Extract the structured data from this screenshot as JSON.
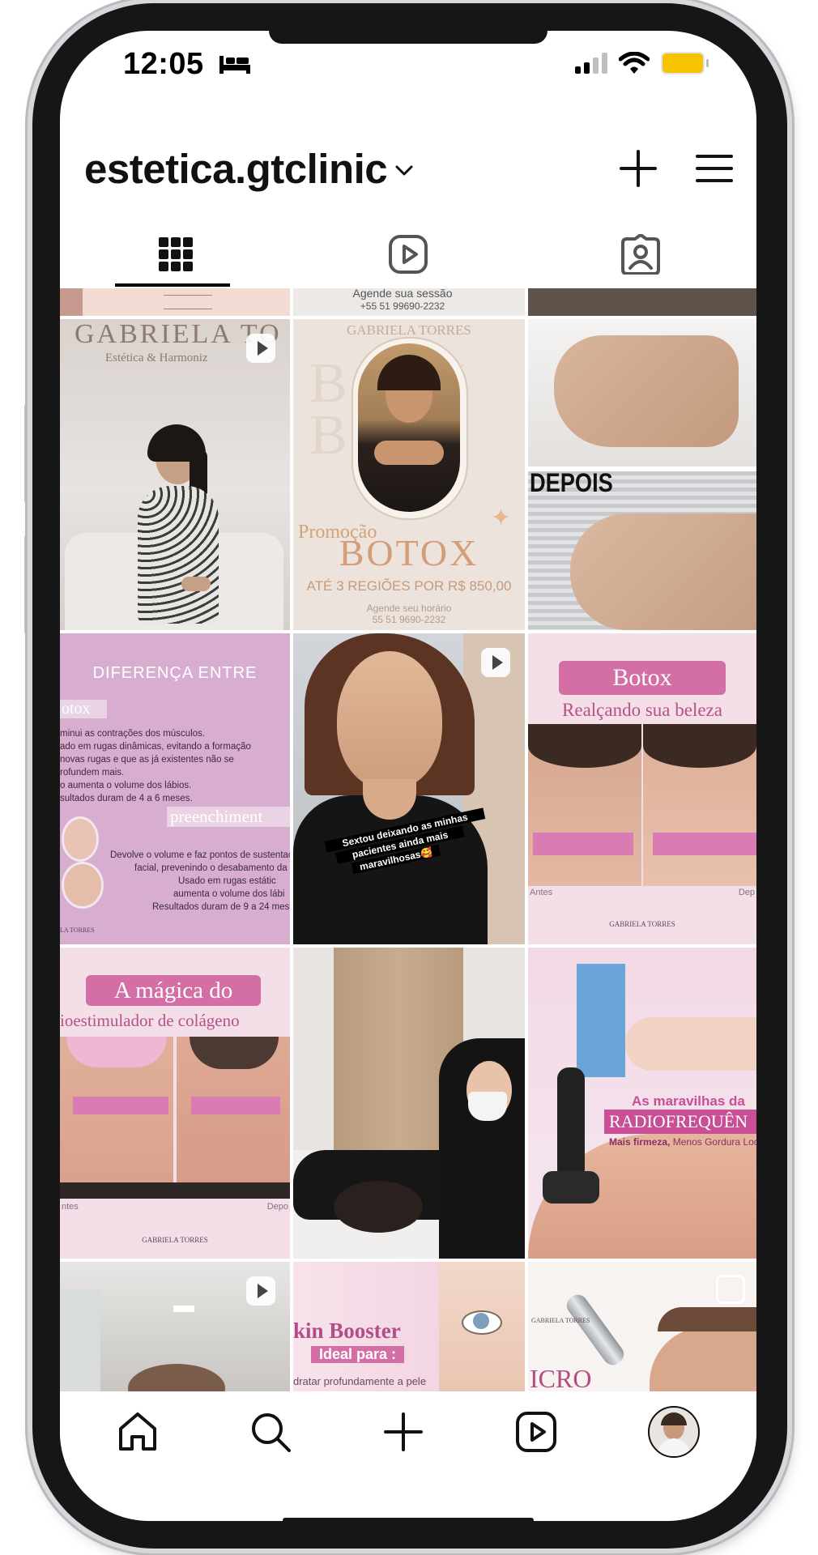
{
  "status_bar": {
    "time": "12:05"
  },
  "header": {
    "username": "estetica.gtclinic"
  },
  "tabs": [
    {
      "name": "posts",
      "icon": "grid-icon",
      "active": true
    },
    {
      "name": "reels",
      "icon": "reels-icon"
    },
    {
      "name": "tagged",
      "icon": "tagged-user-icon"
    }
  ],
  "posts": {
    "row0": {
      "mid_line1": "Agende sua sessão",
      "mid_line2": "+55 51 99690-2232"
    },
    "p1": {
      "sign": "GABRIELA TO",
      "sub": "Estética & Harmoniz",
      "type": "reel"
    },
    "p2": {
      "brand": "GABRIELA TORRES",
      "promo": "Promoção",
      "title": "BOTOX",
      "offer": "ATÉ 3 REGIÕES POR R$ 850,00",
      "footer1": "Agende seu horário",
      "footer2": "55 51 9690-2232",
      "bg_word1": "BO X",
      "bg_word2": "BO X"
    },
    "p3": {
      "label": "DEPOIS"
    },
    "p4": {
      "title": "DIFERENÇA ENTRE",
      "tag1": "otox",
      "lines": [
        "minui as contrações dos músculos.",
        "ado em rugas dinâmicas, evitando a formação",
        "novas rugas e que as já existentes não se",
        "rofundem mais.",
        "o aumenta o volume dos lábios.",
        "sultados duram de 4 a 6 meses."
      ],
      "tag2": "preenchiment",
      "lines2": [
        "Devolve o volume e faz pontos de sustentaç",
        "facial, prevenindo o desabamento da fac",
        "Usado em rugas estátic",
        "aumenta o volume dos lábi",
        "Resultados duram de 9 a 24 mese"
      ],
      "brand": "LA TORRES"
    },
    "p5": {
      "caption1": "Sextou deixando as minhas",
      "caption2": "pacientes ainda mais",
      "caption3": "maravilhosas🥰",
      "type": "reel"
    },
    "p6": {
      "title": "Botox",
      "subtitle": "Realçando sua beleza",
      "before": "Antes",
      "after": "Dep",
      "brand": "GABRIELA TORRES"
    },
    "p7": {
      "title": "A mágica do",
      "subtitle": "ioestimulador de colágeno",
      "before": "ntes",
      "after": "Depo",
      "brand": "GABRIELA TORRES"
    },
    "p9": {
      "line1": "As maravilhas da",
      "line2": "RADIOFREQUÊN",
      "line3a": "Mais firmeza,",
      "line3b": "Menos Gordura Loca"
    },
    "p10": {
      "type": "reel"
    },
    "p11": {
      "title": "kin Booster",
      "subtitle": "Ideal para :",
      "text": "dratar profundamente a pele"
    },
    "p12": {
      "brand": "GABRIELA TORRES",
      "title": "ICRO",
      "type": "carousel"
    }
  },
  "bottom_nav": [
    {
      "name": "home",
      "icon": "home-icon"
    },
    {
      "name": "search",
      "icon": "search-icon"
    },
    {
      "name": "create",
      "icon": "plus-icon"
    },
    {
      "name": "reels",
      "icon": "reels-icon"
    },
    {
      "name": "profile",
      "icon": "avatar"
    }
  ],
  "colors": {
    "accent_pink": "#d36fa5",
    "pale_pink": "#f2d5e2",
    "lilac": "#d4a4cc",
    "text": "#111111"
  }
}
